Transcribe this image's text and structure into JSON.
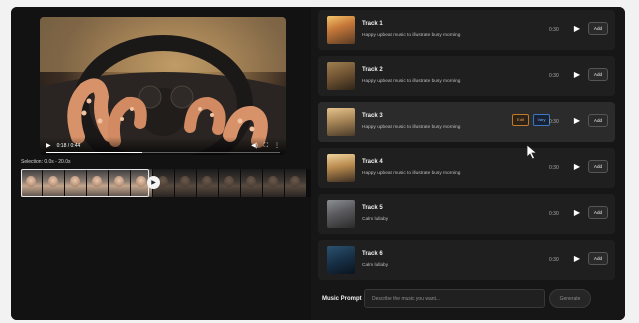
{
  "player": {
    "time": "0:18 / 0:44",
    "progress_fraction": 0.41,
    "play_icon": "play-icon",
    "volume_icon": "volume-icon",
    "fullscreen_icon": "fullscreen-icon",
    "more_icon": "more-vertical-icon"
  },
  "timeline": {
    "selection_label": "Selection: 0.0s - 20.0s",
    "frame_count": 13
  },
  "tracks": [
    {
      "title": "Track 1",
      "desc": "Happy upbeat music to illustrate busy morning",
      "duration": "0:30",
      "add": "Add",
      "thumb": "sunset"
    },
    {
      "title": "Track 2",
      "desc": "Happy upbeat music to illustrate busy morning",
      "duration": "0:30",
      "add": "Add",
      "thumb": "cafe"
    },
    {
      "title": "Track 3",
      "desc": "Happy upbeat music to illustrate busy morning",
      "duration": "0:30",
      "add": "Add",
      "thumb": "street",
      "edit": "Edit",
      "vary": "Vary",
      "hovered": true
    },
    {
      "title": "Track 4",
      "desc": "Happy upbeat music to illustrate busy morning",
      "duration": "0:30",
      "add": "Add",
      "thumb": "city"
    },
    {
      "title": "Track 5",
      "desc": "Calm lullaby",
      "duration": "0:30",
      "add": "Add",
      "thumb": "window"
    },
    {
      "title": "Track 6",
      "desc": "Calm lullaby",
      "duration": "0:30",
      "add": "Add",
      "thumb": "night"
    }
  ],
  "prompt": {
    "label": "Music Prompt",
    "placeholder": "Describe the music you want...",
    "value": "",
    "generate_label": "Generate"
  },
  "colors": {
    "edit_accent": "#c07a2c",
    "vary_accent": "#3c78c3",
    "panel_bg": "#141414"
  }
}
